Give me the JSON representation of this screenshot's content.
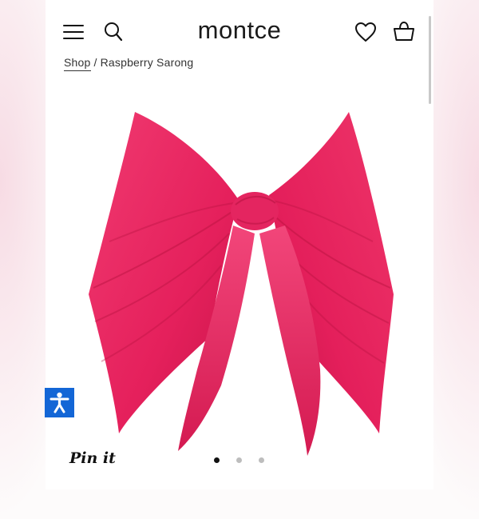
{
  "header": {
    "logo": "montce",
    "icons": [
      "menu-icon",
      "search-icon",
      "heart-icon",
      "shopping-bag-icon"
    ]
  },
  "breadcrumb": {
    "link": "Shop",
    "separator": "/",
    "current": "Raspberry Sarong"
  },
  "product": {
    "image_subject": "raspberry-pink-tied-sarong",
    "color": "#e9215f"
  },
  "gallery": {
    "pin_label": "Pin it",
    "slide_count": 3,
    "active_slide": 1
  },
  "accessibility": {
    "icon": "accessibility-icon",
    "color": "#1366d6"
  }
}
